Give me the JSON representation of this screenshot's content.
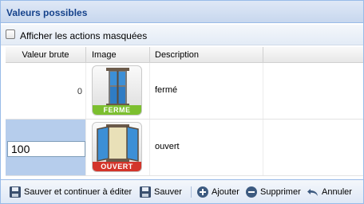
{
  "panel": {
    "title": "Valeurs possibles"
  },
  "toolbar": {
    "checkbox_label": "Afficher les actions masquées"
  },
  "grid": {
    "columns": [
      "Valeur brute",
      "Image",
      "Description",
      ""
    ],
    "rows": [
      {
        "value": "0",
        "image_label": "FERME",
        "image_icon": "closed-window-icon",
        "description": "fermé"
      },
      {
        "value": "100",
        "image_label": "OUVERT",
        "image_icon": "open-window-icon",
        "description": "ouvert"
      }
    ]
  },
  "actions": {
    "save_continue": "Sauver et continuer à éditer",
    "save": "Sauver",
    "add": "Ajouter",
    "delete": "Supprimer",
    "cancel": "Annuler"
  },
  "colors": {
    "header_text": "#15428b",
    "border": "#99bbe8",
    "selected_cell": "#b6cdec",
    "badge_closed": "#7cbf2f",
    "badge_open": "#d3352b"
  }
}
